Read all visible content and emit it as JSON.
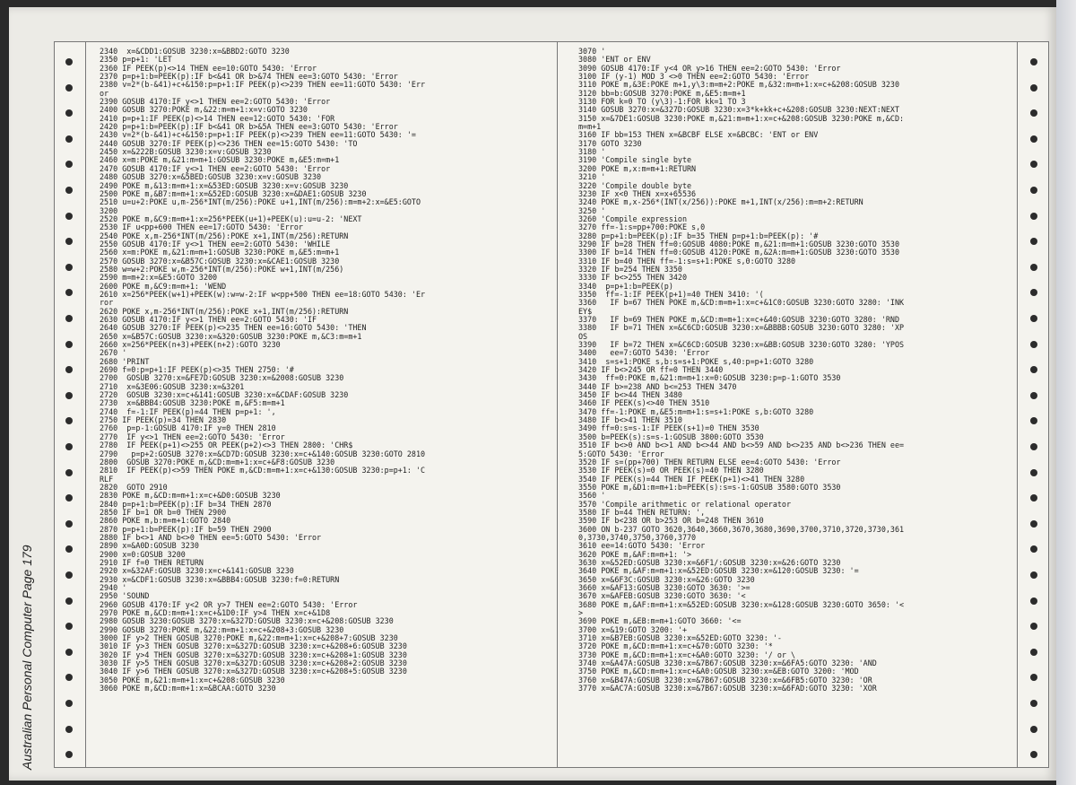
{
  "sidebar": {
    "text": "Australian Personal Computer  Page 179"
  },
  "columns": {
    "left": [
      "2340  x=&CDD1:GOSUB 3230:x=&BBD2:GOTO 3230",
      "2350 p=p+1: 'LET",
      "2360 IF PEEK(p)<>14 THEN ee=10:GOTO 5430: 'Error",
      "2370 p=p+1:b=PEEK(p):IF b<&41 OR b>&74 THEN ee=3:GOTO 5430: 'Error",
      "2380 v=2*(b-&41)+c+&150:p=p+1:IF PEEK(p)<>239 THEN ee=11:GOTO 5430: 'Err",
      "or",
      "2390 GOSUB 4170:IF y<>1 THEN ee=2:GOTO 5430: 'Error",
      "2400 GOSUB 3270:POKE m,&22:m=m+1:x=v:GOTO 3230",
      "2410 p=p+1:IF PEEK(p)<>14 THEN ee=12:GOTO 5430: 'FOR",
      "2420 p=p+1:b=PEEK(p):IF b<&41 OR b>&5A THEN ee=3:GOTO 5430: 'Error",
      "2430 v=2*(b-&41)+c+&150:p=p+1:IF PEEK(p)<>239 THEN ee=11:GOTO 5430: '=",
      "2440 GOSUB 3270:IF PEEK(p)<>236 THEN ee=15:GOTO 5430: 'TO",
      "2450 x=&222B:GOSUB 3230:x=v:GOSUB 3230",
      "2460 x=m:POKE m,&21:m=m+1:GOSUB 3230:POKE m,&E5:m=m+1",
      "2470 GOSUB 4170:IF y<>1 THEN ee=2:GOTO 5430: 'Error",
      "2480 GOSUB 3270:x=&5BED:GOSUB 3230:x=v:GOSUB 3230",
      "2490 POKE m,&13:m=m+1:x=&53ED:GOSUB 3230:x=v:GOSUB 3230",
      "2500 POKE m,&B7:m=m+1:x=&52ED:GOSUB 3230:x=&DAE1:GOSUB 3230",
      "2510 u=u+2:POKE u,m-256*INT(m/256):POKE u+1,INT(m/256):m=m+2:x=&E5:GOTO",
      "3200",
      "2520 POKE m,&C9:m=m+1:x=256*PEEK(u+1)+PEEK(u):u=u-2: 'NEXT",
      "2530 IF u<pp+600 THEN ee=17:GOTO 5430: 'Error",
      "2540 POKE x,m-256*INT(m/256):POKE x+1,INT(m/256):RETURN",
      "2550 GOSUB 4170:IF y<>1 THEN ee=2:GOTO 5430: 'WHILE",
      "2560 x=m:POKE m,&21:m=m+1:GOSUB 3230:POKE m,&E5:m=m+1",
      "2570 GOSUB 3270:x=&B57C:GOSUB 3230:x=&CAE1:GOSUB 3230",
      "2580 w=w+2:POKE w,m-256*INT(m/256):POKE w+1,INT(m/256)",
      "2590 m=m+2:x=&E5:GOTO 3200",
      "2600 POKE m,&C9:m=m+1: 'WEND",
      "2610 x=256*PEEK(w+1)+PEEK(w):w=w-2:IF w<pp+500 THEN ee=18:GOTO 5430: 'Er",
      "ror",
      "2620 POKE x,m-256*INT(m/256):POKE x+1,INT(m/256):RETURN",
      "2630 GOSUB 4170:IF y<>1 THEN ee=2:GOTO 5430: 'IF",
      "2640 GOSUB 3270:IF PEEK(p)<>235 THEN ee=16:GOTO 5430: 'THEN",
      "2650 x=&B57C:GOSUB 3230:x=&320:GOSUB 3230:POKE m,&C3:m=m+1",
      "2660 x=256*PEEK(n+3)+PEEK(n+2):GOTO 3230",
      "2670 '",
      "2680 'PRINT",
      "2690 f=0:p=p+1:IF PEEK(p)<>35 THEN 2750: '#",
      "2700  GOSUB 3270:x=&FE7D:GOSUB 3230:x=&2008:GOSUB 3230",
      "2710  x=&3E06:GOSUB 3230:x=&3201",
      "2720  GOSUB 3230:x=c+&141:GOSUB 3230:x=&CDAF:GOSUB 3230",
      "2730  x=&BBB4:GOSUB 3230:POKE m,&F5:m=m+1",
      "2740  f=-1:IF PEEK(p)=44 THEN p=p+1: ',",
      "2750 IF PEEK(p)=34 THEN 2830",
      "2760  p=p-1:GOSUB 4170:IF y=0 THEN 2810",
      "2770  IF y<>1 THEN ee=2:GOTO 5430: 'Error",
      "2780  IF PEEK(p+1)<>255 OR PEEK(p+2)<>3 THEN 2800: 'CHR$",
      "2790   p=p+2:GOSUB 3270:x=&CD7D:GOSUB 3230:x=c+&140:GOSUB 3230:GOTO 2810",
      "2800  GOSUB 3270:POKE m,&CD:m=m+1:x=c+&F8:GOSUB 3230",
      "2810  IF PEEK(p)<>59 THEN POKE m,&CD:m=m+1:x=c+&130:GOSUB 3230:p=p+1: 'C",
      "RLF",
      "2820  GOTO 2910",
      "2830 POKE m,&CD:m=m+1:x=c+&D0:GOSUB 3230",
      "2840 p=p+1:b=PEEK(p):IF b=34 THEN 2870",
      "2850 IF b=1 OR b=0 THEN 2900",
      "2860 POKE m,b:m=m+1:GOTO 2840",
      "2870 p=p+1:b=PEEK(p):IF b=59 THEN 2900",
      "2880 IF b<>1 AND b<>0 THEN ee=5:GOTO 5430: 'Error",
      "2890 x=&A0D:GOSUB 3230",
      "2900 x=0:GOSUB 3200",
      "2910 IF f=0 THEN RETURN",
      "2920 x=&32AF:GOSUB 3230:x=c+&141:GOSUB 3230",
      "2930 x=&CDF1:GOSUB 3230:x=&BBB4:GOSUB 3230:f=0:RETURN",
      "2940 '",
      "2950 'SOUND",
      "2960 GOSUB 4170:IF y<2 OR y>7 THEN ee=2:GOTO 5430: 'Error",
      "2970 POKE m,&CD:m=m+1:x=c+&1D0:IF y>4 THEN x=c+&1D8",
      "2980 GOSUB 3230:GOSUB 3270:x=&327D:GOSUB 3230:x=c+&208:GOSUB 3230",
      "2990 GOSUB 3270:POKE m,&22:m=m+1:x=c+&208+3:GOSUB 3230",
      "3000 IF y>2 THEN GOSUB 3270:POKE m,&22:m=m+1:x=c+&208+7:GOSUB 3230",
      "3010 IF y>3 THEN GOSUB 3270:x=&327D:GOSUB 3230:x=c+&208+6:GOSUB 3230",
      "3020 IF y>4 THEN GOSUB 3270:x=&327D:GOSUB 3230:x=c+&208+1:GOSUB 3230",
      "3030 IF y>5 THEN GOSUB 3270:x=&327D:GOSUB 3230:x=c+&208+2:GOSUB 3230",
      "3040 IF y>6 THEN GOSUB 3270:x=&327D:GOSUB 3230:x=c+&208+5:GOSUB 3230",
      "3050 POKE m,&21:m=m+1:x=c+&208:GOSUB 3230",
      "3060 POKE m,&CD:m=m+1:x=&BCAA:GOTO 3230"
    ],
    "right": [
      "3070 '",
      "3080 'ENT or ENV",
      "3090 GOSUB 4170:IF y<4 OR y>16 THEN ee=2:GOTO 5430: 'Error",
      "3100 IF (y-1) MOD 3 <>0 THEN ee=2:GOTO 5430: 'Error",
      "3110 POKE m,&3E:POKE m+1,y\\3:m=m+2:POKE m,&32:m=m+1:x=c+&208:GOSUB 3230",
      "3120 bb=b:GOSUB 3270:POKE m,&E5:m=m+1",
      "3130 FOR k=0 TO (y\\3)-1:FOR kk=1 TO 3",
      "3140 GOSUB 3270:x=&327D:GOSUB 3230:x=3*k+kk+c+&208:GOSUB 3230:NEXT:NEXT",
      "3150 x=&7DE1:GOSUB 3230:POKE m,&21:m=m+1:x=c+&208:GOSUB 3230:POKE m,&CD:",
      "m=m+1",
      "3160 IF bb=153 THEN x=&BCBF ELSE x=&BCBC: 'ENT or ENV",
      "3170 GOTO 3230",
      "3180 '",
      "3190 'Compile single byte",
      "3200 POKE m,x:m=m+1:RETURN",
      "3210 '",
      "3220 'Compile double byte",
      "3230 IF x<0 THEN x=x+65536",
      "3240 POKE m,x-256*(INT(x/256)):POKE m+1,INT(x/256):m=m+2:RETURN",
      "3250 '",
      "3260 'Compile expression",
      "3270 ff=-1:s=pp+700:POKE s,0",
      "3280 p=p+1:b=PEEK(p):IF b=35 THEN p=p+1:b=PEEK(p): '#",
      "3290 IF b=28 THEN ff=0:GOSUB 4080:POKE m,&21:m=m+1:GOSUB 3230:GOTO 3530",
      "3300 IF b=14 THEN ff=0:GOSUB 4120:POKE m,&2A:m=m+1:GOSUB 3230:GOTO 3530",
      "3310 IF b=40 THEN ff=-1:s=s+1:POKE s,0:GOTO 3280",
      "3320 IF b=254 THEN 3350",
      "3330 IF b<>255 THEN 3420",
      "3340  p=p+1:b=PEEK(p)",
      "3350  ff=-1:IF PEEK(p+1)=40 THEN 3410: '(",
      "3360   IF b=67 THEN POKE m,&CD:m=m+1:x=c+&1C0:GOSUB 3230:GOTO 3280: 'INK",
      "EY$",
      "3370   IF b=69 THEN POKE m,&CD:m=m+1:x=c+&40:GOSUB 3230:GOTO 3280: 'RND",
      "3380   IF b=71 THEN x=&C6CD:GOSUB 3230:x=&BBBB:GOSUB 3230:GOTO 3280: 'XP",
      "OS",
      "3390   IF b=72 THEN x=&C6CD:GOSUB 3230:x=&BB:GOSUB 3230:GOTO 3280: 'YPOS",
      "3400   ee=7:GOTO 5430: 'Error",
      "3410  s=s+1:POKE s,b:s=s+1:POKE s,40:p=p+1:GOTO 3280",
      "3420 IF b<>245 OR ff=0 THEN 3440",
      "3430  ff=0:POKE m,&21:m=m+1:x=0:GOSUB 3230:p=p-1:GOTO 3530",
      "3440 IF b>=238 AND b<=253 THEN 3470",
      "3450 IF b<>44 THEN 3480",
      "3460 IF PEEK(s)<>40 THEN 3510",
      "3470 ff=-1:POKE m,&E5:m=m+1:s=s+1:POKE s,b:GOTO 3280",
      "3480 IF b<>41 THEN 3510",
      "3490 ff=0:s=s-1:IF PEEK(s+1)=0 THEN 3530",
      "3500 b=PEEK(s):s=s-1:GOSUB 3800:GOTO 3530",
      "3510 IF b<>0 AND b<>1 AND b<>44 AND b<>59 AND b<>235 AND b<>236 THEN ee=",
      "5:GOTO 5430: 'Error",
      "3520 IF s=(pp+700) THEN RETURN ELSE ee=4:GOTO 5430: 'Error",
      "3530 IF PEEK(s)=0 OR PEEK(s)=40 THEN 3280",
      "3540 IF PEEK(s)=44 THEN IF PEEK(p+1)<>41 THEN 3280",
      "3550 POKE m,&D1:m=m+1:b=PEEK(s):s=s-1:GOSUB 3580:GOTO 3530",
      "3560 '",
      "3570 'Compile arithmetic or relational operator",
      "3580 IF b=44 THEN RETURN: ',",
      "3590 IF b<238 OR b>253 OR b=248 THEN 3610",
      "3600 ON b-237 GOTO 3620,3640,3660,3670,3680,3690,3700,3710,3720,3730,361",
      "0,3730,3740,3750,3760,3770",
      "3610 ee=14:GOTO 5430: 'Error",
      "3620 POKE m,&AF:m=m+1: '>",
      "3630 x=&52ED:GOSUB 3230:x=&6F1/:GOSUB 3230:x=&26:GOTO 3230",
      "3640 POKE m,&AF:m=m+1:x=&52ED:GOSUB 3230:x=&120:GOSUB 3230: '=",
      "3650 x=&6F3C:GOSUB 3230:x=&26:GOTO 3230",
      "3660 x=&AF13:GOSUB 3230:GOTO 3630: '>=",
      "3670 x=&AFEB:GOSUB 3230:GOTO 3630: '<",
      "3680 POKE m,&AF:m=m+1:x=&52ED:GOSUB 3230:x=&128:GOSUB 3230:GOTO 3650: '<",
      ">",
      "3690 POKE m,&EB:m=m+1:GOTO 3660: '<=",
      "3700 x=&19:GOTO 3200: '+",
      "3710 x=&B7EB:GOSUB 3230:x=&52ED:GOTO 3230: '-",
      "3720 POKE m,&CD:m=m+1:x=c+&70:GOTO 3230: '*",
      "3730 POKE m,&CD:m=m+1:x=c+&A0:GOTO 3230: '/ or \\",
      "3740 x=&A47A:GOSUB 3230:x=&7B67:GOSUB 3230:x=&6FA5:GOTO 3230: 'AND",
      "3750 POKE m,&CD:m=m+1:x=c+&A0:GOSUB 3230:x=&EB:GOTO 3200: 'MOD",
      "3760 x=&B47A:GOSUB 3230:x=&7B67:GOSUB 3230:x=&6FB5:GOTO 3230: 'OR",
      "3770 x=&AC7A:GOSUB 3230:x=&7B67:GOSUB 3230:x=&6FAD:GOTO 3230: 'XOR"
    ]
  }
}
